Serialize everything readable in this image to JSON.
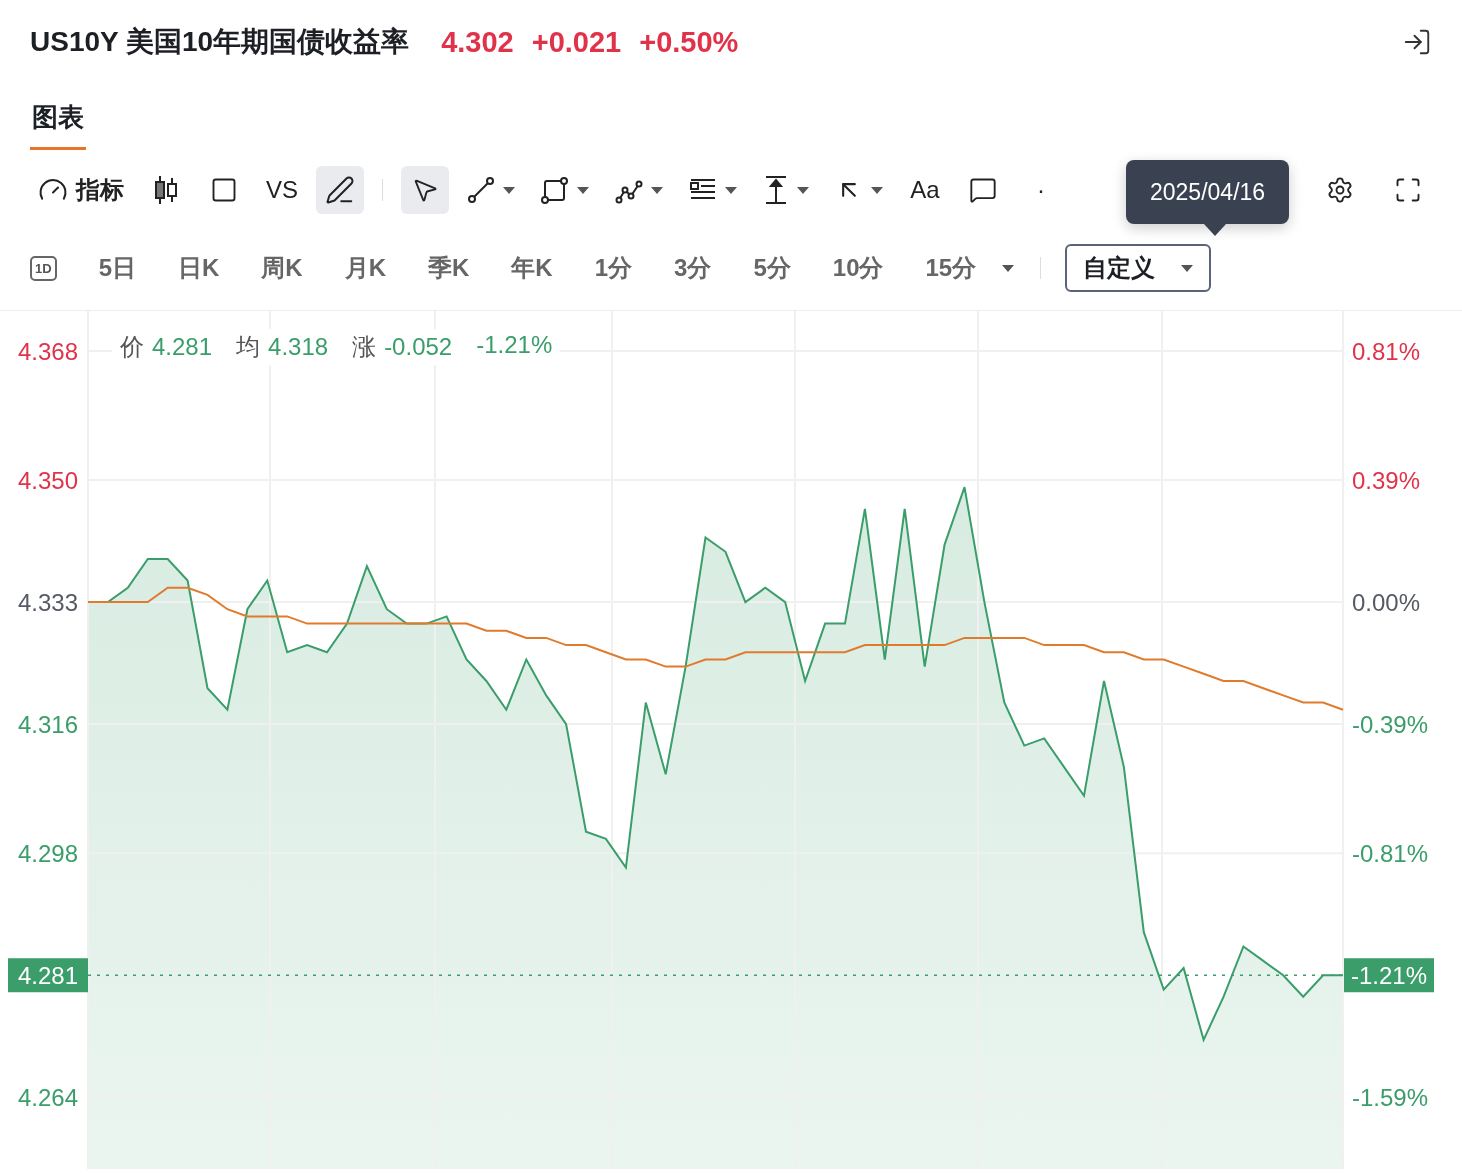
{
  "header": {
    "symbol": "US10Y 美国10年期国债收益率",
    "price": "4.302",
    "change": "+0.021",
    "change_pct": "+0.50%"
  },
  "tabs": [
    {
      "label": "图表",
      "selected": true
    }
  ],
  "toolbar": [
    {
      "kind": "text-icon",
      "label": "指标",
      "selected": false
    },
    {
      "kind": "icon",
      "selected": false
    },
    {
      "kind": "icon",
      "selected": false
    },
    {
      "kind": "text",
      "label": "VS",
      "selected": false
    },
    {
      "kind": "icon",
      "selected": true
    },
    {
      "kind": "separator"
    },
    {
      "kind": "icon",
      "selected": true
    },
    {
      "kind": "dropdown",
      "selected": false
    },
    {
      "kind": "dropdown",
      "selected": false
    },
    {
      "kind": "dropdown",
      "selected": false
    },
    {
      "kind": "dropdown",
      "selected": false
    },
    {
      "kind": "dropdown",
      "selected": false
    },
    {
      "kind": "dropdown",
      "selected": false
    },
    {
      "kind": "text",
      "label": "Aa",
      "selected": false
    },
    {
      "kind": "icon",
      "selected": false
    },
    {
      "kind": "text",
      "label": "·",
      "selected": false
    }
  ],
  "tooltip": "2025/04/16",
  "periods": [
    {
      "kind": "icon",
      "label": "1D",
      "selected": false
    },
    {
      "kind": "text",
      "label": "5日",
      "selected": false
    },
    {
      "kind": "text",
      "label": "日K",
      "selected": false
    },
    {
      "kind": "text",
      "label": "周K",
      "selected": false
    },
    {
      "kind": "text",
      "label": "月K",
      "selected": false
    },
    {
      "kind": "text",
      "label": "季K",
      "selected": false
    },
    {
      "kind": "text",
      "label": "年K",
      "selected": false
    },
    {
      "kind": "text",
      "label": "1分",
      "selected": false
    },
    {
      "kind": "text",
      "label": "3分",
      "selected": false
    },
    {
      "kind": "text",
      "label": "5分",
      "selected": false
    },
    {
      "kind": "text",
      "label": "10分",
      "selected": false
    },
    {
      "kind": "dropdown",
      "label": "15分",
      "selected": false
    },
    {
      "kind": "separator"
    },
    {
      "kind": "dropdown",
      "label": "自定义",
      "selected": true
    }
  ],
  "legend": [
    {
      "value": "4.281"
    },
    {
      "value": "4.318"
    },
    {
      "label": "涨",
      "value": "-0.052"
    },
    {
      "value": "-1.21%"
    }
  ],
  "chart": {
    "chart_data": {
      "type": "line",
      "ylim": [
        4.254,
        4.373
      ],
      "grid": true,
      "yticks": [
        {
          "value": 4.368,
          "label": "4.368"
        },
        {
          "value": 4.35,
          "label": "4.350"
        },
        {
          "value": 4.333,
          "label": "4.333"
        },
        {
          "value": 4.316,
          "label": "4.316"
        },
        {
          "value": 4.298,
          "label": "4.298"
        },
        {
          "value": 4.264,
          "label": "4.264"
        }
      ],
      "series": [
        {
          "name": "价",
          "color": "#3a9d6a",
          "values": [
            4.333,
            4.333,
            4.335,
            4.339,
            4.339,
            4.336,
            4.321,
            4.318,
            4.332,
            4.336,
            4.326,
            4.327,
            4.326,
            4.33,
            4.338,
            4.332,
            4.33,
            4.33,
            4.331,
            4.325,
            4.322,
            4.318,
            4.325,
            4.32,
            4.316,
            4.301,
            4.3,
            4.296,
            4.319,
            4.309,
            4.324,
            4.342,
            4.34,
            4.333,
            4.335,
            4.333,
            4.322,
            4.33,
            4.33,
            4.346,
            4.325,
            4.346,
            4.324,
            4.341,
            4.349,
            4.333,
            4.319,
            4.313,
            4.314,
            4.31,
            4.306,
            4.322,
            4.31,
            4.287,
            4.279,
            4.282,
            4.272,
            4.278,
            4.285,
            4.283,
            4.281,
            4.278,
            4.281,
            4.281
          ]
        },
        {
          "name": "均",
          "color": "#e07b2c",
          "values": [
            4.333,
            4.333,
            4.333,
            4.333,
            4.335,
            4.335,
            4.334,
            4.332,
            4.331,
            4.331,
            4.331,
            4.33,
            4.33,
            4.33,
            4.33,
            4.33,
            4.33,
            4.33,
            4.33,
            4.33,
            4.329,
            4.329,
            4.328,
            4.328,
            4.327,
            4.327,
            4.326,
            4.325,
            4.325,
            4.324,
            4.324,
            4.325,
            4.325,
            4.326,
            4.326,
            4.326,
            4.326,
            4.326,
            4.326,
            4.327,
            4.327,
            4.327,
            4.327,
            4.327,
            4.328,
            4.328,
            4.328,
            4.328,
            4.327,
            4.327,
            4.327,
            4.326,
            4.326,
            4.325,
            4.325,
            4.324,
            4.323,
            4.322,
            4.322,
            4.321,
            4.32,
            4.319,
            4.319,
            4.318
          ]
        }
      ]
    },
    "right_labels": [
      {
        "label": "0.81%",
        "color": "#e0334a"
      },
      {
        "label": "0.39%",
        "color": "#e0334a"
      },
      {
        "label": "0.00%",
        "color": "#555a63"
      },
      {
        "label": "-0.39%",
        "color": "#3a9d6a"
      },
      {
        "label": "-0.81%",
        "color": "#3a9d6a"
      },
      {
        "label": "-1.59%",
        "color": "#3a9d6a"
      }
    ],
    "last_price": {
      "label": "4.281",
      "pct": "-1.21%"
    }
  }
}
